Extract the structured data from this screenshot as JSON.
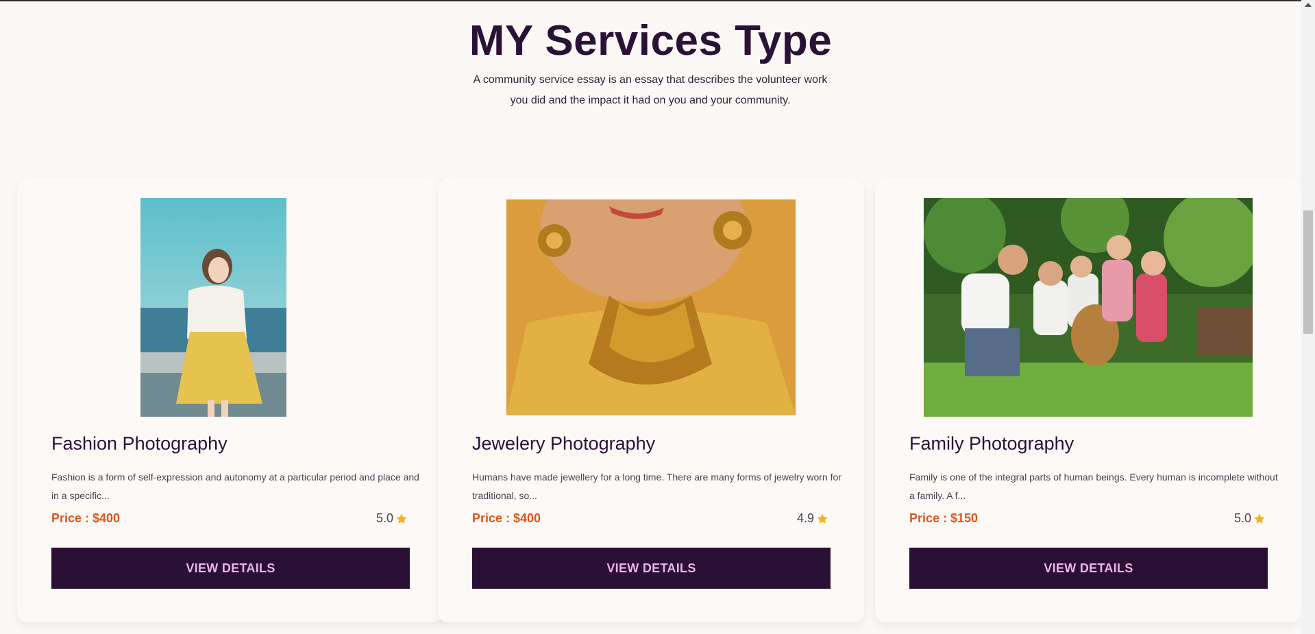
{
  "section": {
    "title": "MY Services Type",
    "subtitle": "A community service essay is an essay that describes the volunteer work you did and the impact it had on you and your community."
  },
  "cards": [
    {
      "title": "Fashion Photography",
      "description": "Fashion is a form of self-expression and autonomy at a particular period and place and in a specific...",
      "price": "Price : $400",
      "rating": "5.0",
      "button": "VIEW DETAILS",
      "image": "fashion-photo"
    },
    {
      "title": "Jewelery Photography",
      "description": "Humans have made jewellery for a long time. There are many forms of jewelry worn for traditional, so...",
      "price": "Price : $400",
      "rating": "4.9",
      "button": "VIEW DETAILS",
      "image": "jewelry-photo"
    },
    {
      "title": "Family Photography",
      "description": "Family is one of the integral parts of human beings. Every human is incomplete without a family. A f...",
      "price": "Price : $150",
      "rating": "5.0",
      "button": "VIEW DETAILS",
      "image": "family-photo"
    }
  ],
  "colors": {
    "heading": "#2a1237",
    "price": "#e0571b",
    "button_bg": "#2a1034",
    "button_text": "#ebb3ec",
    "star": "#f5b020"
  }
}
